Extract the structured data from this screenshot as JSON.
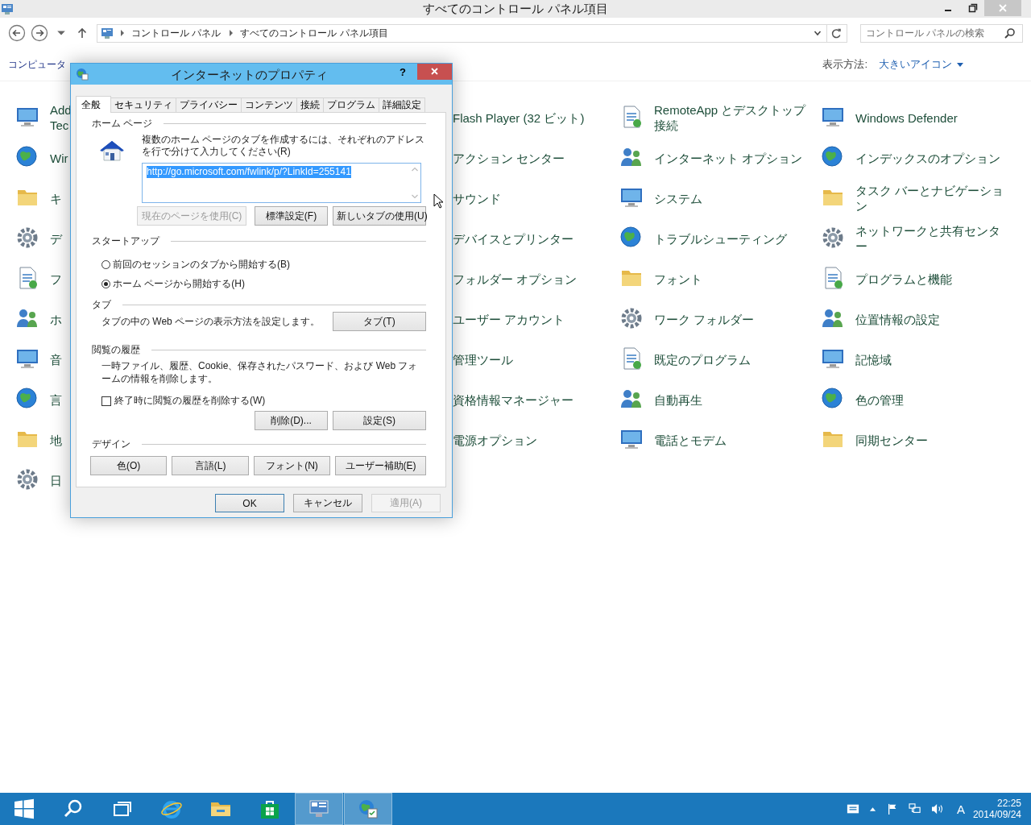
{
  "window": {
    "title": "すべてのコントロール パネル項目"
  },
  "address_bar": {
    "breadcrumbs": [
      "コントロール パネル",
      "すべてのコントロール パネル項目"
    ]
  },
  "search": {
    "placeholder": "コントロール パネルの検索"
  },
  "header": {
    "heading": "コンピュータ",
    "view_label": "表示方法:",
    "view_value": "大きいアイコン"
  },
  "columns": [
    {
      "kind": "cut",
      "items": [
        "Add\nTec",
        "Wir",
        "キ",
        "デ",
        "フ",
        "ホ",
        "音",
        "言",
        "地",
        "日"
      ]
    },
    {
      "kind": "labels",
      "items": [
        "Flash Player (32 ビット)",
        "アクション センター",
        "サウンド",
        "デバイスとプリンター",
        "フォルダー オプション",
        "ユーザー アカウント",
        "管理ツール",
        "資格情報マネージャー",
        "電源オプション"
      ]
    },
    {
      "kind": "full",
      "items": [
        "RemoteApp とデスクトップ接続",
        "インターネット オプション",
        "システム",
        "トラブルシューティング",
        "フォント",
        "ワーク フォルダー",
        "既定のプログラム",
        "自動再生",
        "電話とモデム"
      ]
    },
    {
      "kind": "full",
      "items": [
        "Windows Defender",
        "インデックスのオプション",
        "タスク バーとナビゲーション",
        "ネットワークと共有センター",
        "プログラムと機能",
        "位置情報の設定",
        "記憶域",
        "色の管理",
        "同期センター"
      ]
    }
  ],
  "dialog": {
    "title": "インターネットのプロパティ",
    "help": "?",
    "tabs": [
      {
        "label": "全般",
        "selected": true
      },
      {
        "label": "セキュリティ",
        "selected": false
      },
      {
        "label": "プライバシー",
        "selected": false
      },
      {
        "label": "コンテンツ",
        "selected": false
      },
      {
        "label": "接続",
        "selected": false
      },
      {
        "label": "プログラム",
        "selected": false
      },
      {
        "label": "詳細設定",
        "selected": false
      }
    ],
    "home_page": {
      "heading": "ホーム ページ",
      "description": "複数のホーム ページのタブを作成するには、それぞれのアドレスを行で分けて入力してください(R)",
      "value": "http://go.microsoft.com/fwlink/p/?LinkId=255141",
      "buttons": [
        {
          "label": "現在のページを使用(C)",
          "disabled": true
        },
        {
          "label": "標準設定(F)",
          "disabled": false
        },
        {
          "label": "新しいタブの使用(U)",
          "disabled": false
        }
      ]
    },
    "startup": {
      "heading": "スタートアップ",
      "options": [
        {
          "label": "前回のセッションのタブから開始する(B)",
          "selected": false
        },
        {
          "label": "ホーム ページから開始する(H)",
          "selected": true
        }
      ]
    },
    "tabs_section": {
      "heading": "タブ",
      "description": "タブの中の Web ページの表示方法を設定します。",
      "button": "タブ(T)"
    },
    "history": {
      "heading": "閲覧の履歴",
      "description": "一時ファイル、履歴、Cookie、保存されたパスワード、および Web フォームの情報を削除します。",
      "checkbox": {
        "label": "終了時に閲覧の履歴を削除する(W)",
        "checked": false
      },
      "buttons": [
        "削除(D)...",
        "設定(S)"
      ]
    },
    "design": {
      "heading": "デザイン",
      "buttons": [
        "色(O)",
        "言語(L)",
        "フォント(N)",
        "ユーザー補助(E)"
      ]
    },
    "footer_buttons": [
      {
        "label": "OK",
        "default": true,
        "disabled": false
      },
      {
        "label": "キャンセル",
        "default": false,
        "disabled": false
      },
      {
        "label": "適用(A)",
        "default": false,
        "disabled": true
      }
    ]
  },
  "taskbar": {
    "apps": [
      {
        "kind": "start",
        "selected": false
      },
      {
        "kind": "search",
        "selected": false
      },
      {
        "kind": "windows",
        "selected": false
      },
      {
        "kind": "browser",
        "selected": false
      },
      {
        "kind": "folder",
        "selected": false
      },
      {
        "kind": "store",
        "selected": false
      },
      {
        "kind": "panel",
        "selected": true
      },
      {
        "kind": "globe",
        "selected": true
      }
    ],
    "tray": {
      "input_mode": "A",
      "time": "22:25",
      "date": "2014/09/24"
    }
  }
}
